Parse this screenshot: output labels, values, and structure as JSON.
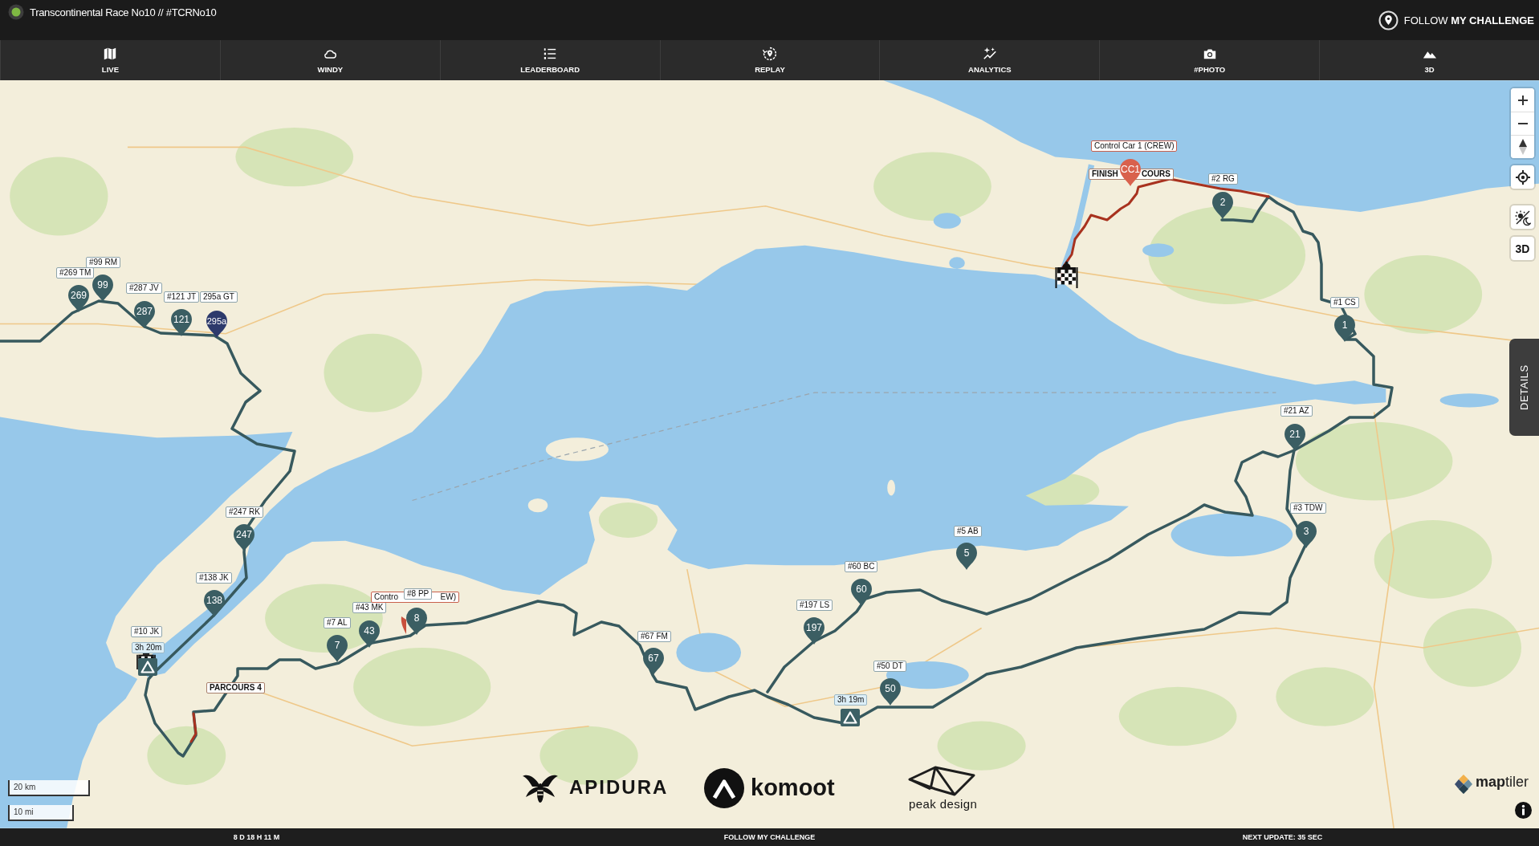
{
  "header": {
    "title": "Transcontinental Race No10 // #TCRNo10",
    "follow_button": "FOLLOW **MY CHALLENGE**"
  },
  "nav_tabs": [
    "LIVE",
    "WINDY",
    "LEADERBOARD",
    "REPLAY",
    "ANALYTICS",
    "#PHOTO",
    "3D"
  ],
  "map": {
    "tags": [
      {
        "kind": "rider",
        "text": "#269 TM"
      },
      {
        "kind": "rider",
        "text": "#99 RM"
      },
      {
        "kind": "rider",
        "text": "#287 JV"
      },
      {
        "kind": "rider",
        "text": "#121 JT"
      },
      {
        "kind": "rider",
        "text": "295a GT"
      },
      {
        "kind": "rider",
        "text": "#247 RK"
      },
      {
        "kind": "rider",
        "text": "#138 JK"
      },
      {
        "kind": "rider",
        "text": "#10 JK"
      },
      {
        "kind": "time",
        "text": "3h 20m"
      },
      {
        "kind": "course",
        "text": "PARCOURS 4"
      },
      {
        "kind": "rider",
        "text": "#7 AL"
      },
      {
        "kind": "rider",
        "text": "#43 MK"
      },
      {
        "kind": "crew",
        "parts": [
          "Contro",
          "EW)"
        ]
      },
      {
        "kind": "rider",
        "text": "#8 PP"
      },
      {
        "kind": "rider",
        "text": "#67 FM"
      },
      {
        "kind": "rider",
        "text": "#197 LS"
      },
      {
        "kind": "rider",
        "text": "#60 BC"
      },
      {
        "kind": "rider",
        "text": "#5 AB"
      },
      {
        "kind": "rider",
        "text": "#50 DT"
      },
      {
        "kind": "time",
        "text": "3h 19m"
      },
      {
        "kind": "rider",
        "text": "#3 TDW"
      },
      {
        "kind": "rider",
        "text": "#21 AZ"
      },
      {
        "kind": "rider",
        "text": "#1 CS"
      },
      {
        "kind": "rider",
        "text": "#2 RG"
      },
      {
        "kind": "crew",
        "text": "Control Car 1 (CREW)"
      },
      {
        "kind": "course",
        "parts": [
          "FINISH",
          "COURS"
        ]
      }
    ],
    "pins": [
      {
        "text": "269",
        "color": "#3b5e63"
      },
      {
        "text": "99",
        "color": "#3b5e63"
      },
      {
        "text": "287",
        "color": "#3b5e63"
      },
      {
        "text": "121",
        "color": "#3b5e63"
      },
      {
        "text": "295a",
        "color": "#2d3a6c"
      },
      {
        "text": "247",
        "color": "#3b5e63"
      },
      {
        "text": "138",
        "color": "#3b5e63"
      },
      {
        "text": "7",
        "color": "#3b5e63"
      },
      {
        "text": "43",
        "color": "#3b5e63"
      },
      {
        "color": "#c9503c"
      },
      {
        "text": "8",
        "color": "#3b5e63"
      },
      {
        "text": "67",
        "color": "#3b5e63"
      },
      {
        "text": "197",
        "color": "#3b5e63"
      },
      {
        "text": "60",
        "color": "#3b5e63"
      },
      {
        "text": "5",
        "color": "#3b5e63"
      },
      {
        "text": "50",
        "color": "#3b5e63"
      },
      {
        "text": "3",
        "color": "#3b5e63"
      },
      {
        "text": "21",
        "color": "#3b5e63"
      },
      {
        "text": "1",
        "color": "#3b5e63"
      },
      {
        "text": "2",
        "color": "#3b5e63"
      },
      {
        "text": "CC1",
        "color": "#d9614d"
      }
    ],
    "view_3d_button": "3D",
    "details_tab": "DETAILS",
    "scale": [
      "20 km",
      "10 mi"
    ],
    "sponsors": [
      "APIDURA",
      "komoot",
      "peak design"
    ],
    "provider": "**map**tiler"
  },
  "status_bar": {
    "elapsed": "8 D 18 H 11 M",
    "follow_link": "FOLLOW MY CHALLENGE",
    "next_update": "NEXT UPDATE: 35 SEC"
  }
}
